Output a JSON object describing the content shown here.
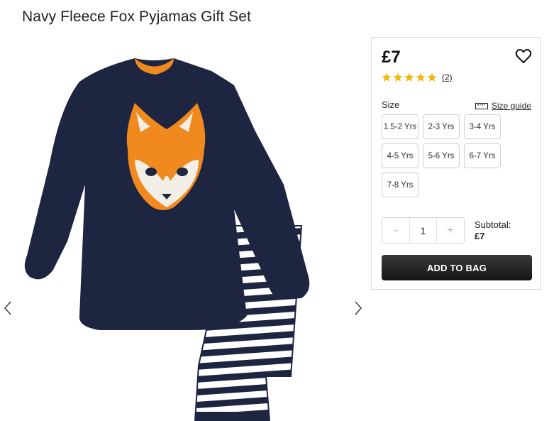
{
  "product": {
    "title": "Navy Fleece Fox Pyjamas Gift Set",
    "image_alt": "navy-fleece-fox-pyjamas-image"
  },
  "gallery": {
    "prev_icon": "chevron-left-icon",
    "next_icon": "chevron-right-icon"
  },
  "panel": {
    "price": "£7",
    "wishlist_icon": "heart-icon",
    "rating": {
      "stars": 5,
      "max": 5,
      "review_count": "(2)",
      "star_color": "#f5b50a"
    },
    "size_label": "Size",
    "size_guide_label": "Size guide",
    "sizes": [
      "1.5-2 Yrs",
      "2-3 Yrs",
      "3-4 Yrs",
      "4-5 Yrs",
      "5-6 Yrs",
      "6-7 Yrs",
      "7-8 Yrs"
    ],
    "quantity": {
      "minus": "-",
      "value": "1",
      "plus": "+"
    },
    "subtotal_label": "Subtotal:",
    "subtotal_value": "£7",
    "add_to_bag": "ADD TO BAG"
  },
  "colors": {
    "navy": "#1d2540",
    "orange": "#f08a1e",
    "button_dark": "#1e1e1e"
  }
}
